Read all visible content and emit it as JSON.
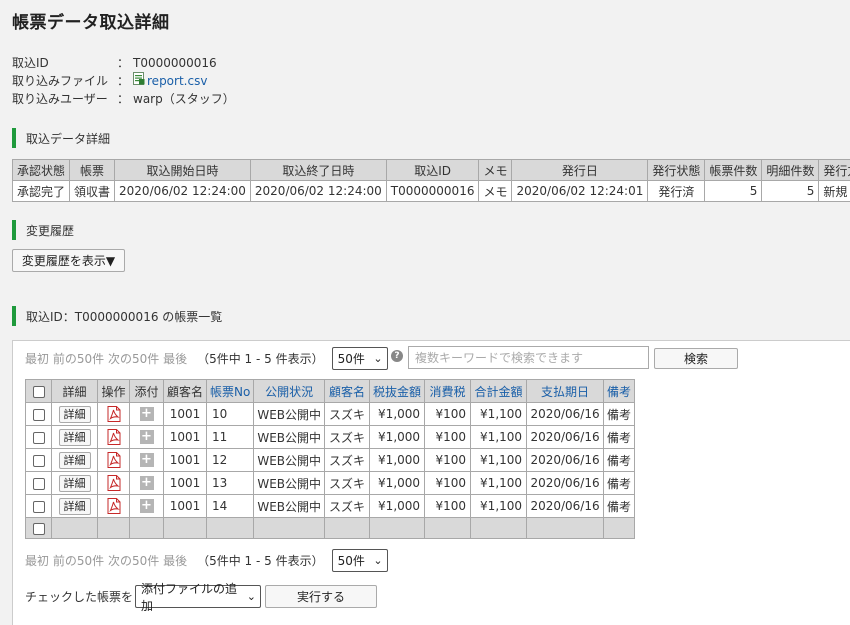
{
  "page": {
    "title": "帳票データ取込詳細"
  },
  "meta": [
    {
      "label": "取込ID",
      "value": "T0000000016",
      "link": false
    },
    {
      "label": "取り込みファイル",
      "value": "report.csv",
      "link": true
    },
    {
      "label": "取り込みユーザー",
      "value": "warp（スタッフ）",
      "link": false
    }
  ],
  "colon": "：",
  "sections": {
    "detail": "取込データ詳細",
    "history": "変更履歴",
    "list": "取込ID：T0000000016 の帳票一覧"
  },
  "detail_table": {
    "headers": [
      "承認状態",
      "帳票",
      "取込開始日時",
      "取込終了日時",
      "取込ID",
      "メモ",
      "発行日",
      "発行状態",
      "帳票件数",
      "明細件数",
      "発行方法"
    ],
    "row": [
      "承認完了",
      "領収書",
      "2020/06/02 12:24:00",
      "2020/06/02 12:24:00",
      "T0000000016",
      "メモ",
      "2020/06/02 12:24:01",
      "発行済",
      "5",
      "5",
      "新規"
    ]
  },
  "history_button": "変更履歴を表示▼",
  "pager": {
    "first": "最初",
    "prev": "前の50件",
    "next": "次の50件",
    "last": "最後",
    "status": "（5件中 1 - 5 件表示）",
    "per_page": "50件"
  },
  "search": {
    "placeholder": "複数キーワードで検索できます",
    "button": "検索",
    "help": "?"
  },
  "list_table": {
    "headers": [
      {
        "label": "",
        "link": false
      },
      {
        "label": "詳細",
        "link": false
      },
      {
        "label": "操作",
        "link": false
      },
      {
        "label": "添付",
        "link": false
      },
      {
        "label": "顧客名",
        "link": false
      },
      {
        "label": "帳票No",
        "link": true
      },
      {
        "label": "公開状況",
        "link": true
      },
      {
        "label": "顧客名",
        "link": true
      },
      {
        "label": "税抜金額",
        "link": true
      },
      {
        "label": "消費税",
        "link": true
      },
      {
        "label": "合計金額",
        "link": true
      },
      {
        "label": "支払期日",
        "link": true
      },
      {
        "label": "備考",
        "link": true
      }
    ],
    "detail_button": "詳細",
    "rows": [
      {
        "customer_code": "1001",
        "no": "10",
        "status": "WEB公開中",
        "customer": "スズキ",
        "subtotal": "¥1,000",
        "tax": "¥100",
        "total": "¥1,100",
        "due": "2020/06/16",
        "note": "備考"
      },
      {
        "customer_code": "1001",
        "no": "11",
        "status": "WEB公開中",
        "customer": "スズキ",
        "subtotal": "¥1,000",
        "tax": "¥100",
        "total": "¥1,100",
        "due": "2020/06/16",
        "note": "備考"
      },
      {
        "customer_code": "1001",
        "no": "12",
        "status": "WEB公開中",
        "customer": "スズキ",
        "subtotal": "¥1,000",
        "tax": "¥100",
        "total": "¥1,100",
        "due": "2020/06/16",
        "note": "備考"
      },
      {
        "customer_code": "1001",
        "no": "13",
        "status": "WEB公開中",
        "customer": "スズキ",
        "subtotal": "¥1,000",
        "tax": "¥100",
        "total": "¥1,100",
        "due": "2020/06/16",
        "note": "備考"
      },
      {
        "customer_code": "1001",
        "no": "14",
        "status": "WEB公開中",
        "customer": "スズキ",
        "subtotal": "¥1,000",
        "tax": "¥100",
        "total": "¥1,100",
        "due": "2020/06/16",
        "note": "備考"
      }
    ]
  },
  "bulk_action": {
    "label": "チェックした帳票を",
    "selected": "添付ファイルの追加",
    "run_button": "実行する"
  },
  "colors": {
    "accent_green": "#1f9a3c",
    "link_blue": "#1a5fa8",
    "header_gray": "#d9d9d9"
  }
}
